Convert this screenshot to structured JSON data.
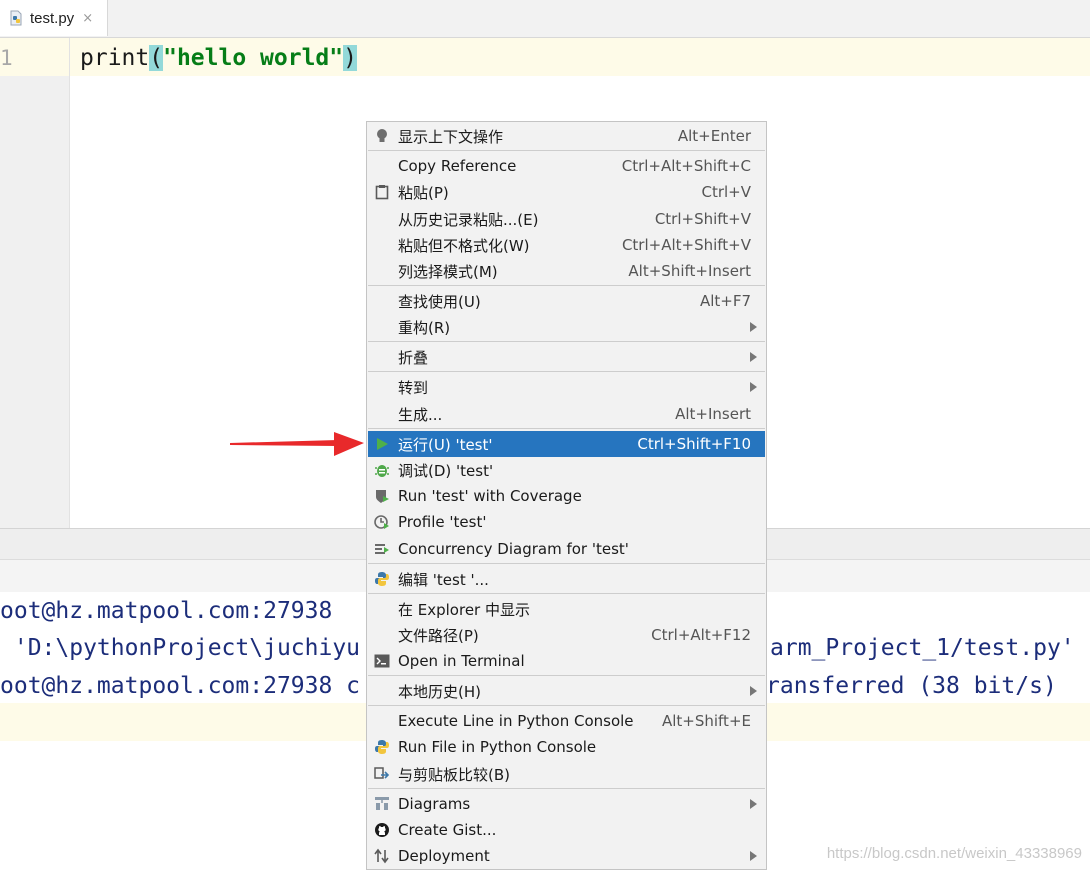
{
  "tab": {
    "label": "test.py",
    "close": "×"
  },
  "editor": {
    "line_number": "1",
    "code": {
      "fn": "print",
      "open": "(",
      "string": "\"hello world\"",
      "close": ")"
    }
  },
  "console": {
    "line1": "oot@hz.matpool.com:27938",
    "line2_a": " 'D:\\pythonProject\\juchiyu",
    "line2_b": "arm_Project_1/test.py'",
    "line3_a": "oot@hz.matpool.com:27938 c",
    "line3_b": "ransferred (38 bit/s)"
  },
  "menu": {
    "items": [
      {
        "label": "显示上下文操作",
        "shortcut": "Alt+Enter",
        "icon": "lightbulb-icon"
      },
      {
        "label": "Copy Reference",
        "shortcut": "Ctrl+Alt+Shift+C",
        "icon": ""
      },
      {
        "label": "粘贴(P)",
        "shortcut": "Ctrl+V",
        "icon": "clipboard-icon"
      },
      {
        "label": "从历史记录粘贴...(E)",
        "shortcut": "Ctrl+Shift+V",
        "icon": ""
      },
      {
        "label": "粘贴但不格式化(W)",
        "shortcut": "Ctrl+Alt+Shift+V",
        "icon": ""
      },
      {
        "label": "列选择模式(M)",
        "shortcut": "Alt+Shift+Insert",
        "icon": ""
      },
      {
        "label": "查找使用(U)",
        "shortcut": "Alt+F7",
        "icon": ""
      },
      {
        "label": "重构(R)",
        "shortcut": "",
        "icon": ""
      },
      {
        "label": "折叠",
        "shortcut": "",
        "icon": ""
      },
      {
        "label": "转到",
        "shortcut": "",
        "icon": ""
      },
      {
        "label": "生成...",
        "shortcut": "Alt+Insert",
        "icon": ""
      },
      {
        "label": "运行(U) 'test'",
        "shortcut": "Ctrl+Shift+F10",
        "icon": "run-icon"
      },
      {
        "label": "调试(D) 'test'",
        "shortcut": "",
        "icon": "debug-bug-icon"
      },
      {
        "label": "Run 'test' with Coverage",
        "shortcut": "",
        "icon": "coverage-shield-icon"
      },
      {
        "label": "Profile 'test'",
        "shortcut": "",
        "icon": "profile-clock-icon"
      },
      {
        "label": "Concurrency Diagram for 'test'",
        "shortcut": "",
        "icon": "concurrency-icon"
      },
      {
        "label": "编辑 'test '...",
        "shortcut": "",
        "icon": "python-icon"
      },
      {
        "label": "在 Explorer 中显示",
        "shortcut": "",
        "icon": ""
      },
      {
        "label": "文件路径(P)",
        "shortcut": "Ctrl+Alt+F12",
        "icon": ""
      },
      {
        "label": "Open in Terminal",
        "shortcut": "",
        "icon": "terminal-icon"
      },
      {
        "label": "本地历史(H)",
        "shortcut": "",
        "icon": ""
      },
      {
        "label": "Execute Line in Python Console",
        "shortcut": "Alt+Shift+E",
        "icon": ""
      },
      {
        "label": "Run File in Python Console",
        "shortcut": "",
        "icon": "python-icon"
      },
      {
        "label": "与剪贴板比较(B)",
        "shortcut": "",
        "icon": "compare-icon"
      },
      {
        "label": "Diagrams",
        "shortcut": "",
        "icon": "diagram-icon"
      },
      {
        "label": "Create Gist...",
        "shortcut": "",
        "icon": "github-icon"
      },
      {
        "label": "Deployment",
        "shortcut": "",
        "icon": "deployment-icon"
      }
    ]
  },
  "colors": {
    "selection": "#2675bf",
    "arrow": "#e8292b",
    "string": "#067d17",
    "console_text": "#1c2d7a"
  },
  "watermark": "https://blog.csdn.net/weixin_43338969"
}
